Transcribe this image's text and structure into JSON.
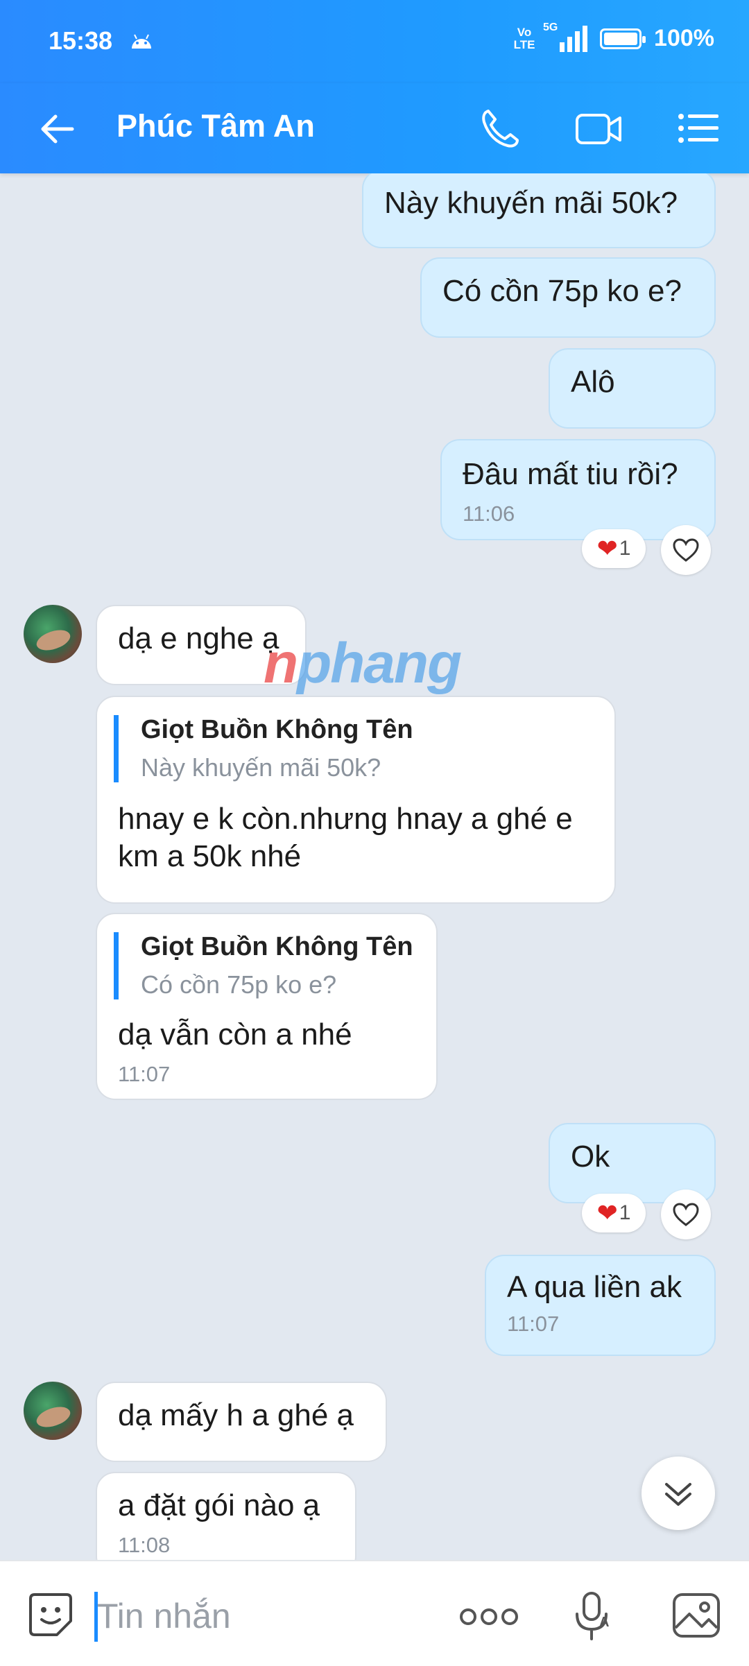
{
  "status_bar": {
    "time": "15:38",
    "network": "5G",
    "volte": "Vo LTE",
    "battery": "100%"
  },
  "header": {
    "contact_name": "Phúc Tâm An"
  },
  "messages": [
    {
      "text": "Này khuyến mãi 50k?"
    },
    {
      "text": "Có cồn 75p ko e?"
    },
    {
      "text": "Alô"
    },
    {
      "text": "Đâu mất tiu rồi?",
      "time": "11:06",
      "reaction_count": "1"
    },
    {
      "text": "dạ e nghe ạ"
    },
    {
      "quote_name": "Giọt Buồn Không Tên",
      "quote_text": "Này khuyến mãi 50k?",
      "text": "hnay e k còn.nhưng hnay a ghé e km a 50k nhé"
    },
    {
      "quote_name": "Giọt Buồn Không Tên",
      "quote_text": "Có cồn 75p ko e?",
      "text": "dạ vẫn còn a nhé",
      "time": "11:07"
    },
    {
      "text": "Ok",
      "reaction_count": "1"
    },
    {
      "text": "A qua liền ak",
      "time": "11:07"
    },
    {
      "text": "dạ mấy h a ghé ạ"
    },
    {
      "text": "a đặt gói nào ạ",
      "time": "11:08"
    }
  ],
  "watermark": {
    "first": "n",
    "rest": "phang"
  },
  "composer": {
    "placeholder": "Tin nhắn"
  },
  "colors": {
    "accent": "#1f9bff",
    "outgoing_bubble": "#d6efff",
    "incoming_bubble": "#ffffff",
    "heart": "#e02424"
  }
}
